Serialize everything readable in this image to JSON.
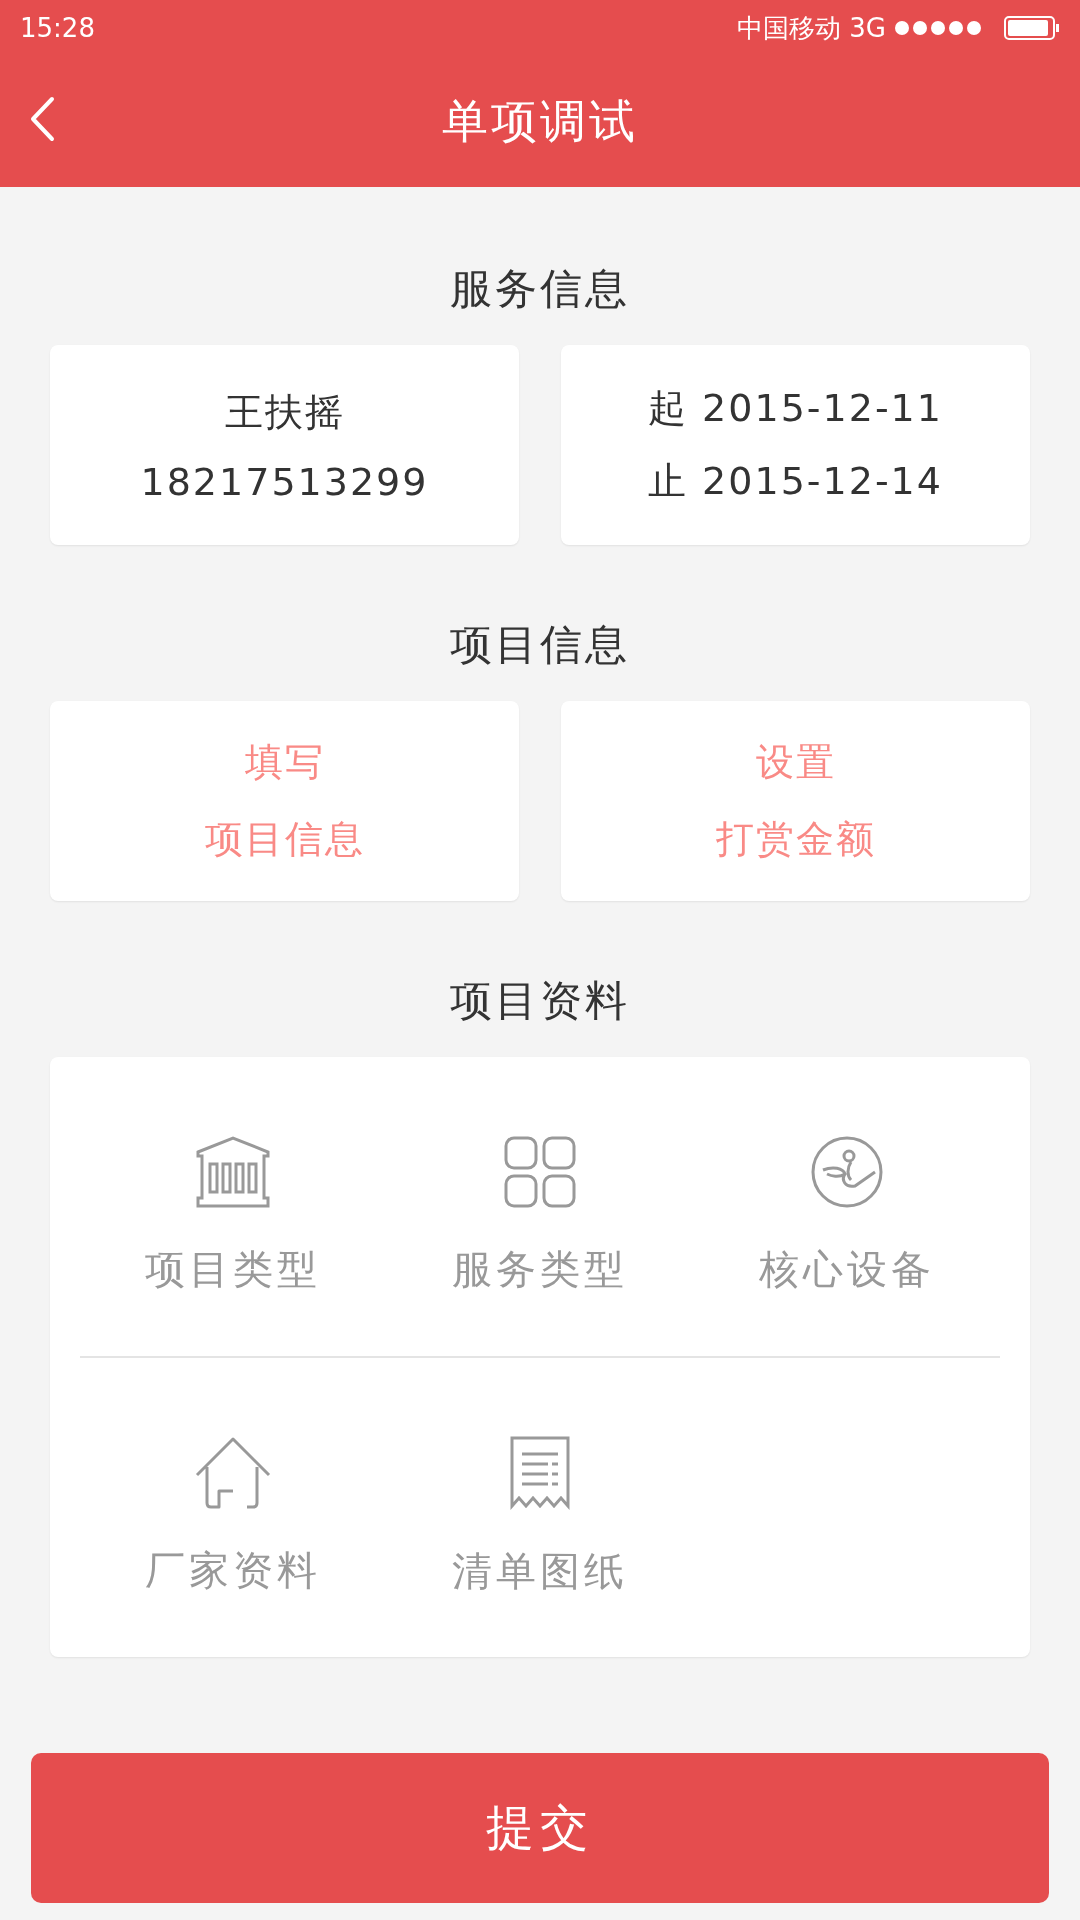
{
  "status_bar": {
    "time": "15:28",
    "carrier": "中国移动",
    "network": "3G"
  },
  "header": {
    "title": "单项调试"
  },
  "service_info": {
    "title": "服务信息",
    "person": {
      "name": "王扶摇",
      "phone": "18217513299"
    },
    "period": {
      "start_label": "起",
      "start": "2015-12-11",
      "end_label": "止",
      "end": "2015-12-14"
    }
  },
  "project_info": {
    "title": "项目信息",
    "actions": [
      {
        "lines": [
          "填写",
          "项目信息"
        ]
      },
      {
        "lines": [
          "设置",
          "打赏金额"
        ]
      }
    ]
  },
  "project_docs": {
    "title": "项目资料",
    "rows": [
      [
        {
          "label": "项目类型",
          "kind": "building"
        },
        {
          "label": "服务类型",
          "kind": "grid"
        },
        {
          "label": "核心设备",
          "kind": "emblem"
        }
      ],
      [
        {
          "label": "厂家资料",
          "kind": "house"
        },
        {
          "label": "清单图纸",
          "kind": "receipt"
        }
      ]
    ]
  },
  "submit": {
    "label": "提交"
  }
}
